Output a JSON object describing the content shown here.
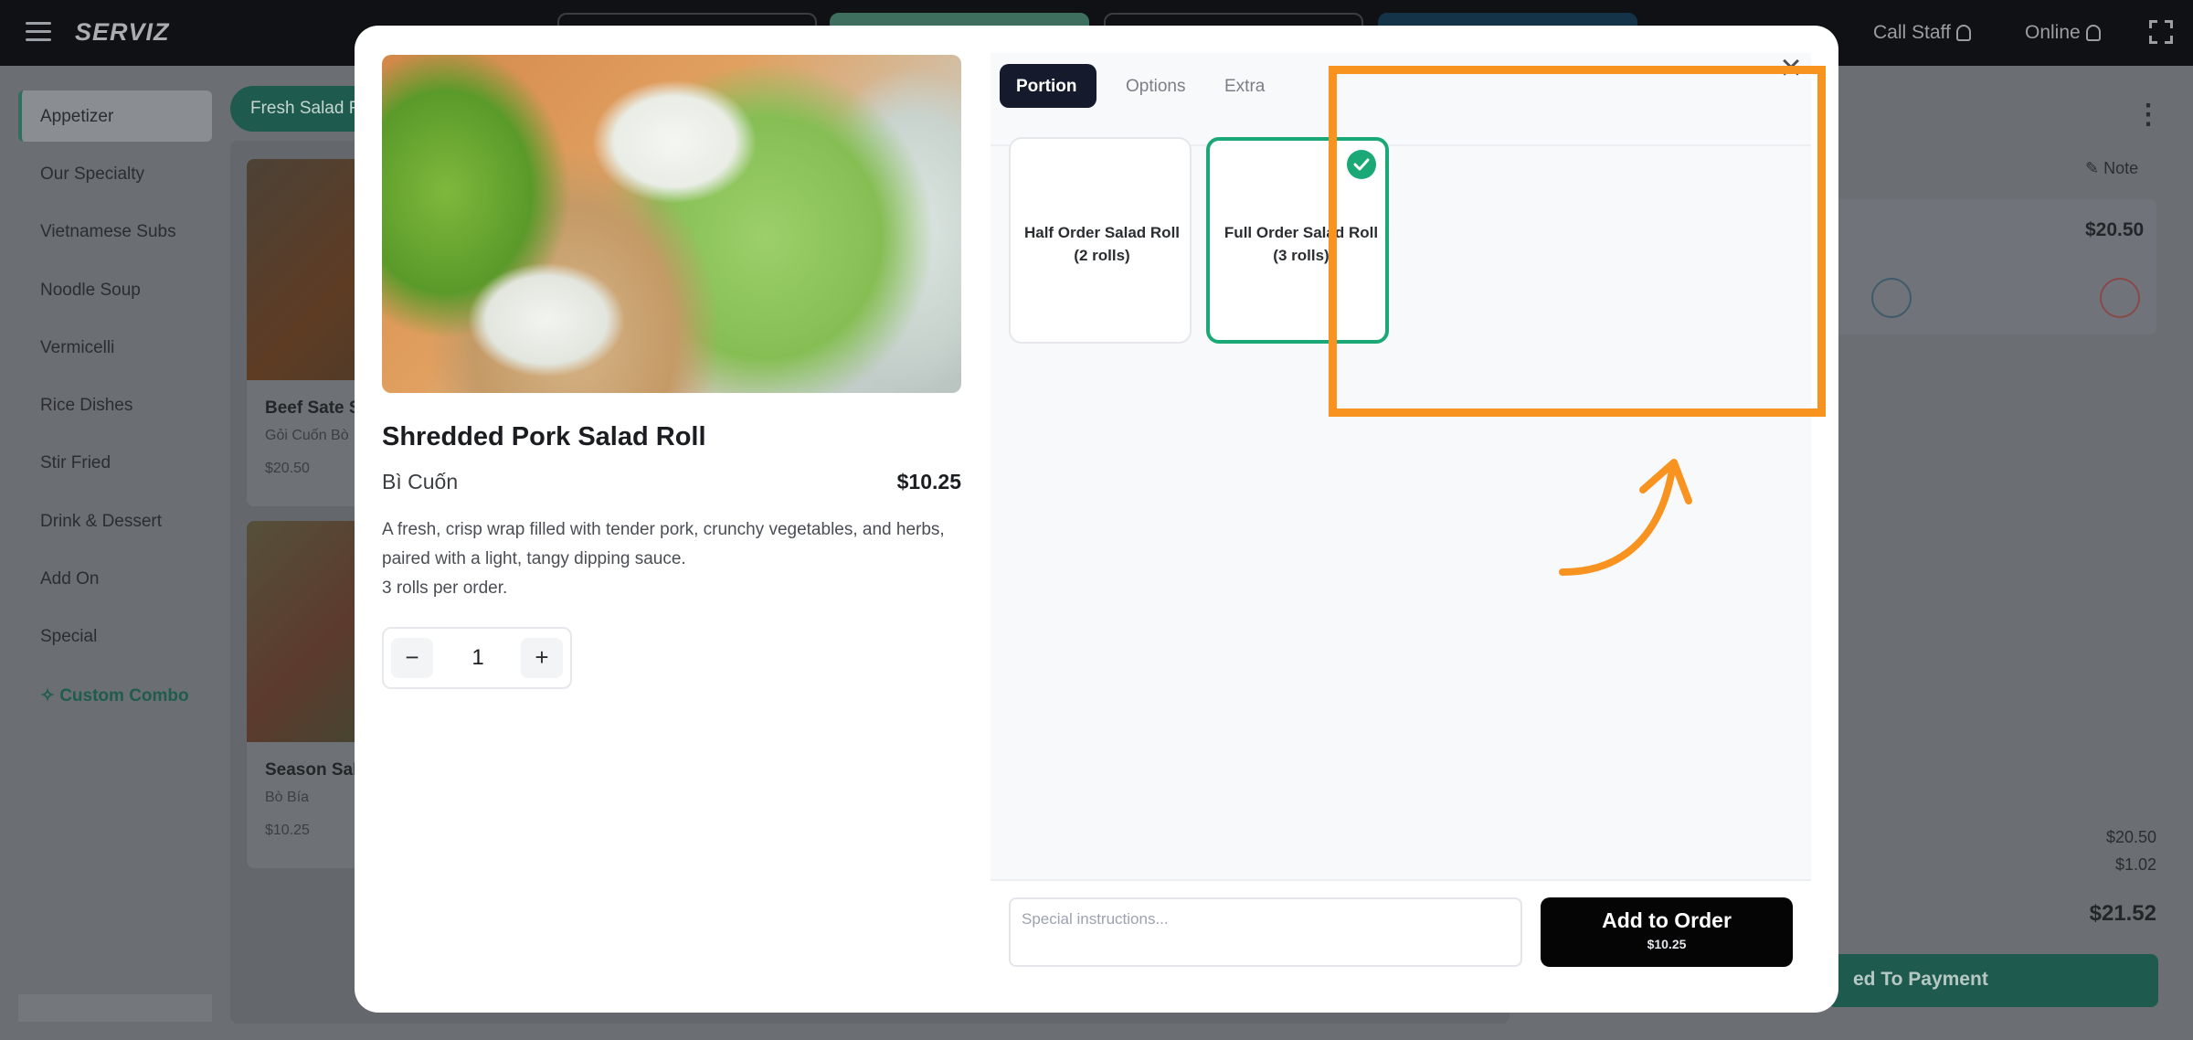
{
  "app": {
    "brand": "SERVIZ",
    "call_staff": "Call Staff",
    "status": "Online"
  },
  "sidebar": {
    "items": [
      {
        "label": "Appetizer"
      },
      {
        "label": "Our Specialty"
      },
      {
        "label": "Vietnamese Subs"
      },
      {
        "label": "Noodle Soup"
      },
      {
        "label": "Vermicelli"
      },
      {
        "label": "Rice Dishes"
      },
      {
        "label": "Stir Fried"
      },
      {
        "label": "Drink & Dessert"
      },
      {
        "label": "Add On"
      },
      {
        "label": "Special"
      }
    ],
    "custom_combo": "Custom Combo"
  },
  "menu": {
    "category_chip": "Fresh Salad R",
    "cards": [
      {
        "title": "Beef Sate S",
        "subtitle": "Gỏi Cuốn Bò",
        "price": "$20.50"
      },
      {
        "title": "Season Sal",
        "subtitle": "Bò Bía",
        "price": "$10.25"
      }
    ]
  },
  "order": {
    "note": "Note",
    "line_price": "$20.50",
    "subtotal": "$20.50",
    "tax": "$1.02",
    "total": "$21.52",
    "payment_button": "ed To Payment"
  },
  "modal": {
    "item": {
      "title": "Shredded Pork Salad Roll",
      "subtitle": "Bì Cuốn",
      "price": "$10.25",
      "description": "A fresh, crisp wrap filled with tender pork, crunchy vegetables, and herbs, paired with a light, tangy dipping sauce.",
      "description_note": "3 rolls per order."
    },
    "quantity": "1",
    "tabs": [
      {
        "label": "Portion",
        "active": true
      },
      {
        "label": "Options",
        "active": false
      },
      {
        "label": "Extra",
        "active": false
      }
    ],
    "portions": [
      {
        "line1": "Half Order Salad Roll",
        "line2": "(2 rolls)",
        "selected": false
      },
      {
        "line1": "Full Order Salad Roll",
        "line2": "(3 rolls)",
        "selected": true
      }
    ],
    "instructions_placeholder": "Special instructions...",
    "add_button": "Add to Order",
    "add_button_price": "$10.25"
  },
  "colors": {
    "accent_green": "#1aa876",
    "annotation_orange": "#f7931e",
    "dark_tab": "#151b2c"
  }
}
